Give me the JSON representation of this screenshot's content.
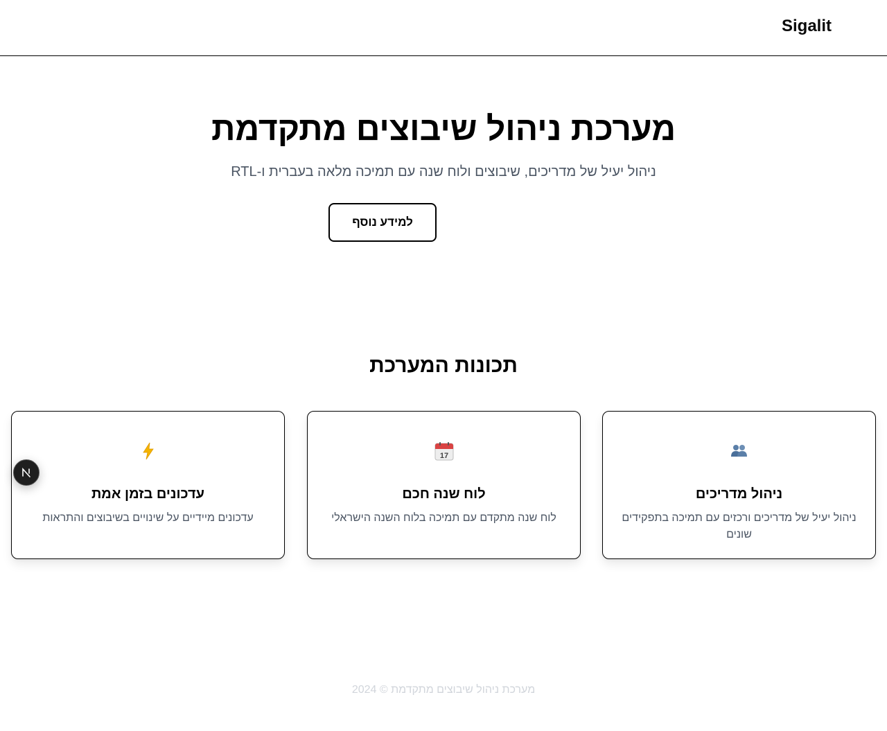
{
  "header": {
    "brand": "Sigalit"
  },
  "hero": {
    "title": "מערכת ניהול שיבוצים מתקדמת",
    "subtitle": "ניהול יעיל של מדריכים, שיבוצים ולוח שנה עם תמיכה מלאה בעברית ו-RTL",
    "cta_label": "למידע נוסף"
  },
  "features": {
    "title": "תכונות המערכת",
    "cards": [
      {
        "icon": "people-icon",
        "title": "ניהול מדריכים",
        "text": "ניהול יעיל של מדריכים ורכזים עם תמיכה בתפקידים שונים"
      },
      {
        "icon": "calendar-icon",
        "title": "לוח שנה חכם",
        "text": "לוח שנה מתקדם עם תמיכה בלוח השנה הישראלי"
      },
      {
        "icon": "lightning-icon",
        "title": "עדכונים בזמן אמת",
        "text": "עדכונים מיידיים על שינויים בשיבוצים והתראות"
      }
    ]
  },
  "footer": {
    "text": "מערכת ניהול שיבוצים מתקדמת © 2024"
  },
  "dev_badge": {
    "icon": "nextjs-n-icon",
    "letter": "N"
  },
  "colors": {
    "subtitle": "#4b5563",
    "footer": "#d1d5db",
    "border": "#000000",
    "lightning": "#f5b400",
    "calendar_red": "#d94343",
    "people_blue": "#4a6f9a"
  }
}
